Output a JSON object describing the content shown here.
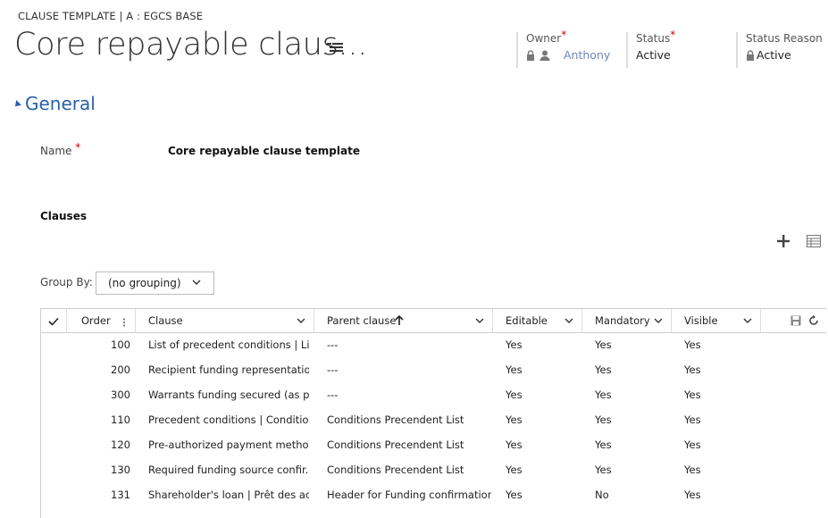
{
  "header": {
    "entity_line": "CLAUSE TEMPLATE | A : EGCS BASE",
    "title": "Core repayable claus...",
    "owner": {
      "label": "Owner",
      "required": "*",
      "value": "Anthony"
    },
    "status": {
      "label": "Status",
      "required": "*",
      "value": "Active"
    },
    "status_reason": {
      "label": "Status Reason",
      "value": "Active"
    }
  },
  "general": {
    "section_title": "General",
    "name_label": "Name",
    "name_required": "*",
    "name_value": "Core repayable clause template"
  },
  "clauses": {
    "label": "Clauses",
    "group_by_label": "Group By:",
    "group_by_value": "(no grouping)",
    "columns": {
      "order": "Order",
      "clause": "Clause",
      "parent_clause": "Parent clause",
      "editable": "Editable",
      "mandatory": "Mandatory",
      "visible": "Visible"
    },
    "rows": [
      {
        "order": "100",
        "clause": "List of precedent conditions | Lis...",
        "parent": "---",
        "editable": "Yes",
        "mandatory": "Yes",
        "visible": "Yes"
      },
      {
        "order": "200",
        "clause": "Recipient funding representatio...",
        "parent": "---",
        "editable": "Yes",
        "mandatory": "Yes",
        "visible": "Yes"
      },
      {
        "order": "300",
        "clause": "Warrants funding secured (as pe...",
        "parent": "---",
        "editable": "Yes",
        "mandatory": "Yes",
        "visible": "Yes"
      },
      {
        "order": "110",
        "clause": "Precedent conditions | Conditio...",
        "parent": "Conditions Precendent List",
        "editable": "Yes",
        "mandatory": "Yes",
        "visible": "Yes"
      },
      {
        "order": "120",
        "clause": "Pre-authorized payment metho...",
        "parent": "Conditions Precendent List",
        "editable": "Yes",
        "mandatory": "Yes",
        "visible": "Yes"
      },
      {
        "order": "130",
        "clause": "Required funding source confir...",
        "parent": "Conditions Precendent List",
        "editable": "Yes",
        "mandatory": "Yes",
        "visible": "Yes"
      },
      {
        "order": "131",
        "clause": "Shareholder's loan | Prêt des act...",
        "parent": "Header for Funding confirmations",
        "editable": "Yes",
        "mandatory": "No",
        "visible": "Yes"
      }
    ]
  },
  "colors": {
    "accent": "#2a5fa8",
    "link": "#6e86b8",
    "required": "#cc0000"
  }
}
